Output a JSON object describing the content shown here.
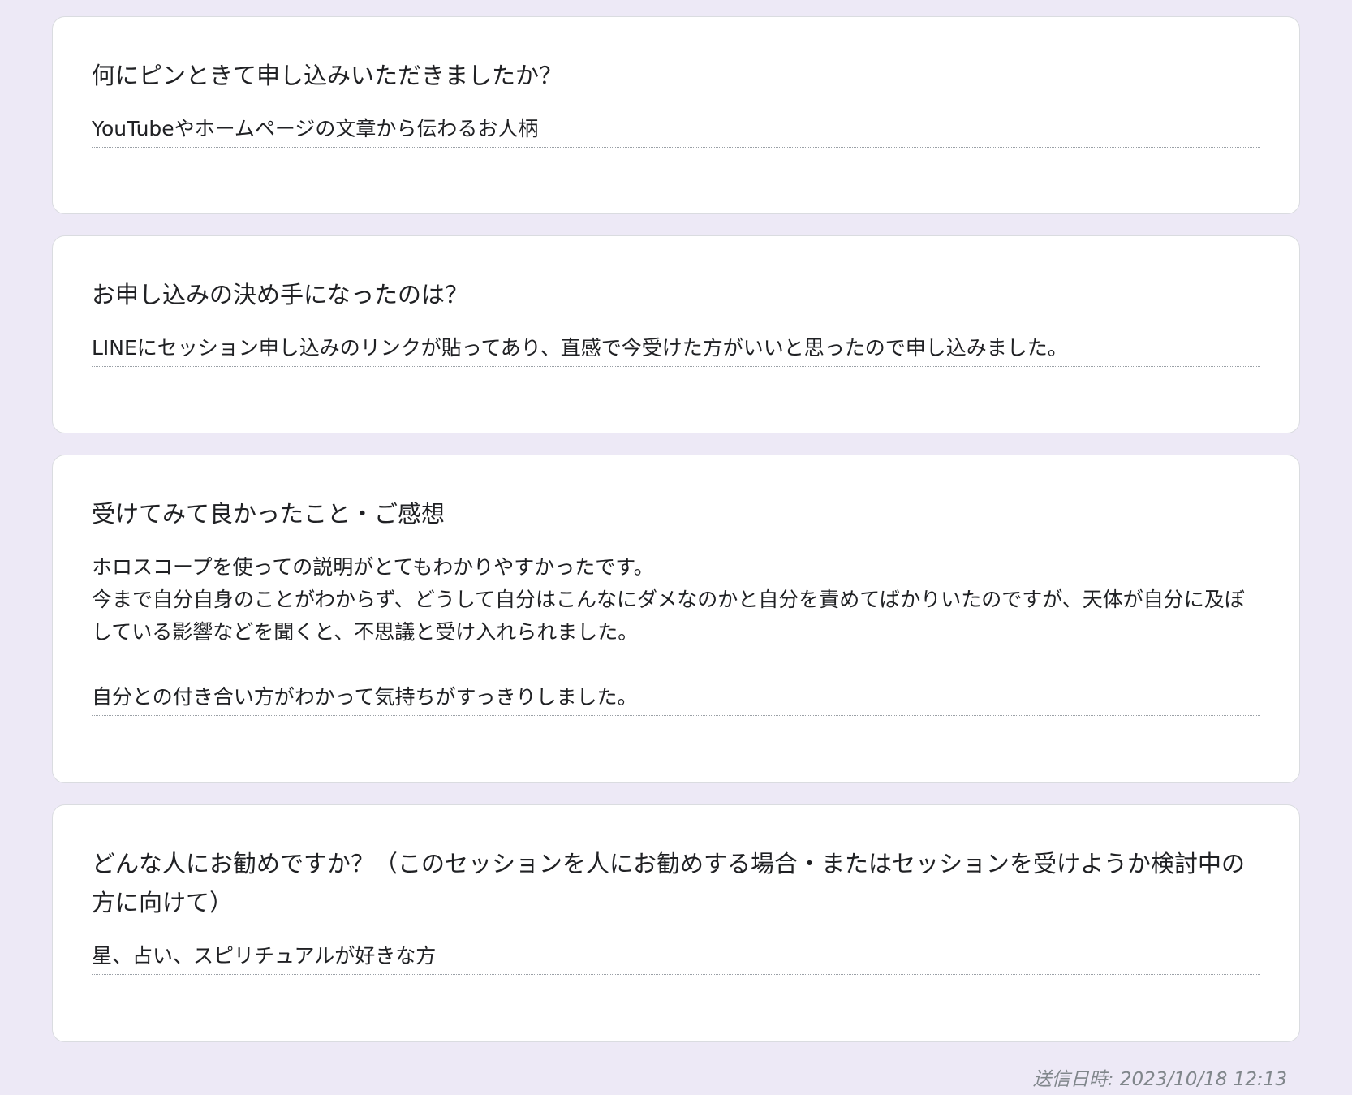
{
  "responses": [
    {
      "question": "何にピンときて申し込みいただきましたか？",
      "answer": "YouTubeやホームページの文章から伝わるお人柄"
    },
    {
      "question": "お申し込みの決め手になったのは？",
      "answer": "LINEにセッション申し込みのリンクが貼ってあり、直感で今受けた方がいいと思ったので申し込みました。"
    },
    {
      "question": "受けてみて良かったこと・ご感想",
      "answer": "ホロスコープを使っての説明がとてもわかりやすかったです。\n今まで自分自身のことがわからず、どうして自分はこんなにダメなのかと自分を責めてばかりいたのですが、天体が自分に及ぼしている影響などを聞くと、不思議と受け入れられました。\n\n自分との付き合い方がわかって気持ちがすっきりしました。"
    },
    {
      "question": "どんな人にお勧めですか？（このセッションを人にお勧めする場合・またはセッションを受けようか検討中の方に向けて）",
      "answer": "星、占い、スピリチュアルが好きな方"
    }
  ],
  "footer": {
    "submitted": "送信日時: 2023/10/18 12:13"
  }
}
